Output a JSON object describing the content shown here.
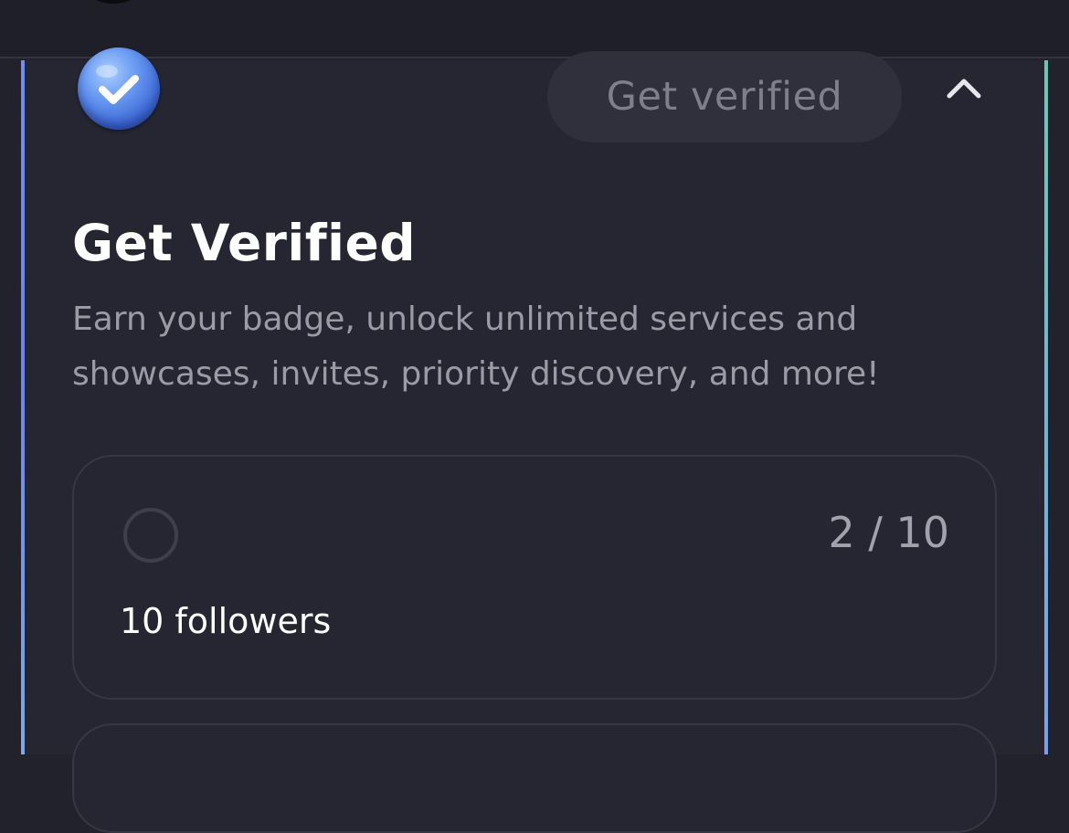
{
  "header": {
    "verify_button_label": "Get verified"
  },
  "section": {
    "title": "Get Verified",
    "description": "Earn your badge, unlock unlimited services and showcases, invites, priority discovery, and more!"
  },
  "requirements": [
    {
      "label": "10 followers",
      "progress_text": "2 / 10",
      "completed": false
    }
  ],
  "icons": {
    "badge": "verified-badge-icon",
    "collapse": "chevron-up-icon",
    "status": "empty-circle-icon"
  },
  "colors": {
    "background": "#22222d",
    "panel": "#262633",
    "accent_left": "#6f8ef3",
    "accent_right": "#68c9b3",
    "badge_blue": "#4f7fe6"
  }
}
